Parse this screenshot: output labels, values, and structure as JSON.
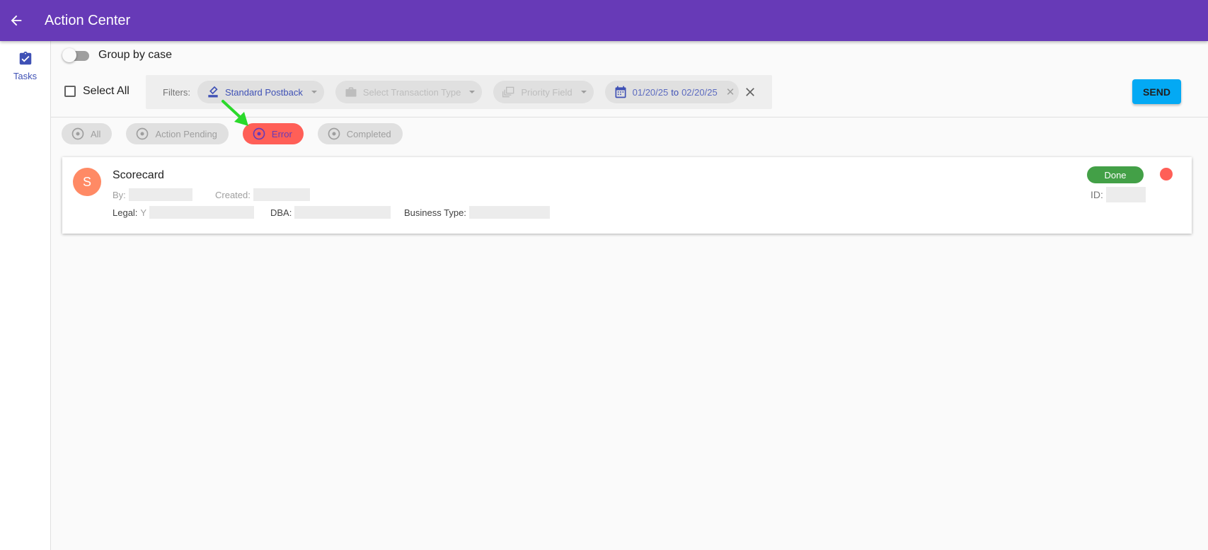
{
  "appbar": {
    "title": "Action Center",
    "back_icon": "arrow-back-icon",
    "color": "#673ab7"
  },
  "sidebar": {
    "items": [
      {
        "label": "Tasks",
        "icon": "clipboard-check-icon"
      }
    ]
  },
  "group_toggle": {
    "label": "Group by case",
    "on": false
  },
  "select_all": {
    "label": "Select All",
    "checked": false
  },
  "filters": {
    "label": "Filters:",
    "postback": {
      "value": "Standard Postback",
      "icon": "postback-icon"
    },
    "transaction": {
      "placeholder": "Select Transaction Type",
      "icon": "briefcase-icon"
    },
    "priority": {
      "placeholder": "Priority Field",
      "icon": "stack-icon"
    },
    "date": {
      "from": "01/20/25",
      "sep": "to",
      "to": "02/20/25",
      "icon": "calendar-icon"
    }
  },
  "send_button": {
    "label": "SEND",
    "color": "#03a9f4"
  },
  "status_filters": [
    {
      "label": "All",
      "selected": false
    },
    {
      "label": "Action Pending",
      "selected": false
    },
    {
      "label": "Error",
      "selected": true
    },
    {
      "label": "Completed",
      "selected": false
    }
  ],
  "task_card": {
    "avatar": "S",
    "title": "Scorecard",
    "by_label": "By:",
    "created_label": "Created:",
    "legal_label": "Legal:",
    "legal_value": "Y",
    "dba_label": "DBA:",
    "business_type_label": "Business Type:",
    "status": "Done",
    "id_label": "ID:",
    "status_color": "#43a047",
    "error_dot_color": "#ff5f57"
  }
}
